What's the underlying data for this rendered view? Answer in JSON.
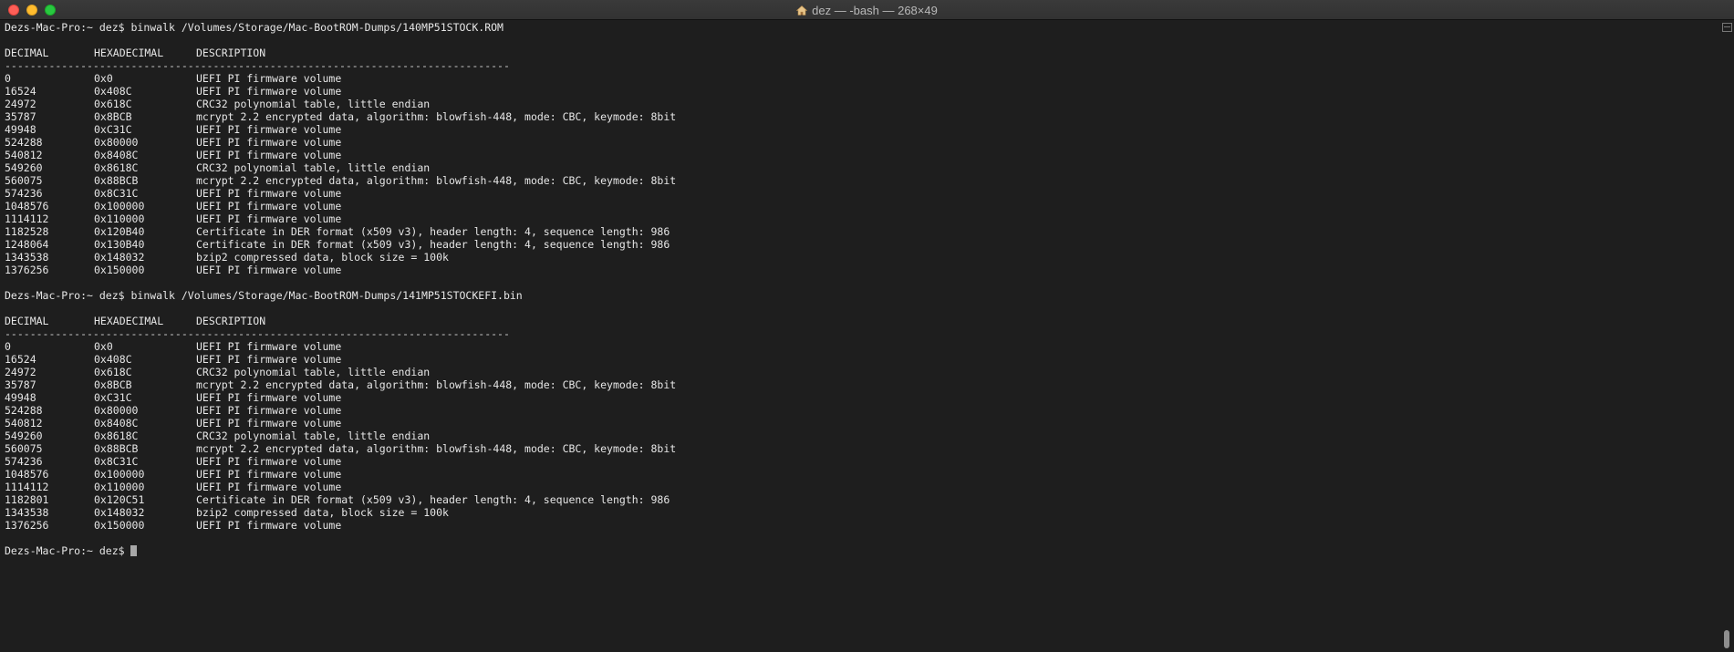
{
  "window": {
    "title": "dez — -bash — 268×49"
  },
  "blocks": [
    {
      "prompt": "Dezs-Mac-Pro:~ dez$ binwalk /Volumes/Storage/Mac-BootROM-Dumps/140MP51STOCK.ROM",
      "headers": [
        "DECIMAL",
        "HEXADECIMAL",
        "DESCRIPTION"
      ],
      "separator": "--------------------------------------------------------------------------------",
      "rows": [
        [
          "0",
          "0x0",
          "UEFI PI firmware volume"
        ],
        [
          "16524",
          "0x408C",
          "UEFI PI firmware volume"
        ],
        [
          "24972",
          "0x618C",
          "CRC32 polynomial table, little endian"
        ],
        [
          "35787",
          "0x8BCB",
          "mcrypt 2.2 encrypted data, algorithm: blowfish-448, mode: CBC, keymode: 8bit"
        ],
        [
          "49948",
          "0xC31C",
          "UEFI PI firmware volume"
        ],
        [
          "524288",
          "0x80000",
          "UEFI PI firmware volume"
        ],
        [
          "540812",
          "0x8408C",
          "UEFI PI firmware volume"
        ],
        [
          "549260",
          "0x8618C",
          "CRC32 polynomial table, little endian"
        ],
        [
          "560075",
          "0x88BCB",
          "mcrypt 2.2 encrypted data, algorithm: blowfish-448, mode: CBC, keymode: 8bit"
        ],
        [
          "574236",
          "0x8C31C",
          "UEFI PI firmware volume"
        ],
        [
          "1048576",
          "0x100000",
          "UEFI PI firmware volume"
        ],
        [
          "1114112",
          "0x110000",
          "UEFI PI firmware volume"
        ],
        [
          "1182528",
          "0x120B40",
          "Certificate in DER format (x509 v3), header length: 4, sequence length: 986"
        ],
        [
          "1248064",
          "0x130B40",
          "Certificate in DER format (x509 v3), header length: 4, sequence length: 986"
        ],
        [
          "1343538",
          "0x148032",
          "bzip2 compressed data, block size = 100k"
        ],
        [
          "1376256",
          "0x150000",
          "UEFI PI firmware volume"
        ]
      ]
    },
    {
      "prompt": "Dezs-Mac-Pro:~ dez$ binwalk /Volumes/Storage/Mac-BootROM-Dumps/141MP51STOCKEFI.bin",
      "headers": [
        "DECIMAL",
        "HEXADECIMAL",
        "DESCRIPTION"
      ],
      "separator": "--------------------------------------------------------------------------------",
      "rows": [
        [
          "0",
          "0x0",
          "UEFI PI firmware volume"
        ],
        [
          "16524",
          "0x408C",
          "UEFI PI firmware volume"
        ],
        [
          "24972",
          "0x618C",
          "CRC32 polynomial table, little endian"
        ],
        [
          "35787",
          "0x8BCB",
          "mcrypt 2.2 encrypted data, algorithm: blowfish-448, mode: CBC, keymode: 8bit"
        ],
        [
          "49948",
          "0xC31C",
          "UEFI PI firmware volume"
        ],
        [
          "524288",
          "0x80000",
          "UEFI PI firmware volume"
        ],
        [
          "540812",
          "0x8408C",
          "UEFI PI firmware volume"
        ],
        [
          "549260",
          "0x8618C",
          "CRC32 polynomial table, little endian"
        ],
        [
          "560075",
          "0x88BCB",
          "mcrypt 2.2 encrypted data, algorithm: blowfish-448, mode: CBC, keymode: 8bit"
        ],
        [
          "574236",
          "0x8C31C",
          "UEFI PI firmware volume"
        ],
        [
          "1048576",
          "0x100000",
          "UEFI PI firmware volume"
        ],
        [
          "1114112",
          "0x110000",
          "UEFI PI firmware volume"
        ],
        [
          "1182801",
          "0x120C51",
          "Certificate in DER format (x509 v3), header length: 4, sequence length: 986"
        ],
        [
          "1343538",
          "0x148032",
          "bzip2 compressed data, block size = 100k"
        ],
        [
          "1376256",
          "0x150000",
          "UEFI PI firmware volume"
        ]
      ]
    }
  ],
  "final_prompt": "Dezs-Mac-Pro:~ dez$ ",
  "colors": {
    "background": "#1e1e1e",
    "text": "#e6e6e6",
    "close": "#fe5f57",
    "minimize": "#febc2e",
    "maximize": "#28c840"
  }
}
